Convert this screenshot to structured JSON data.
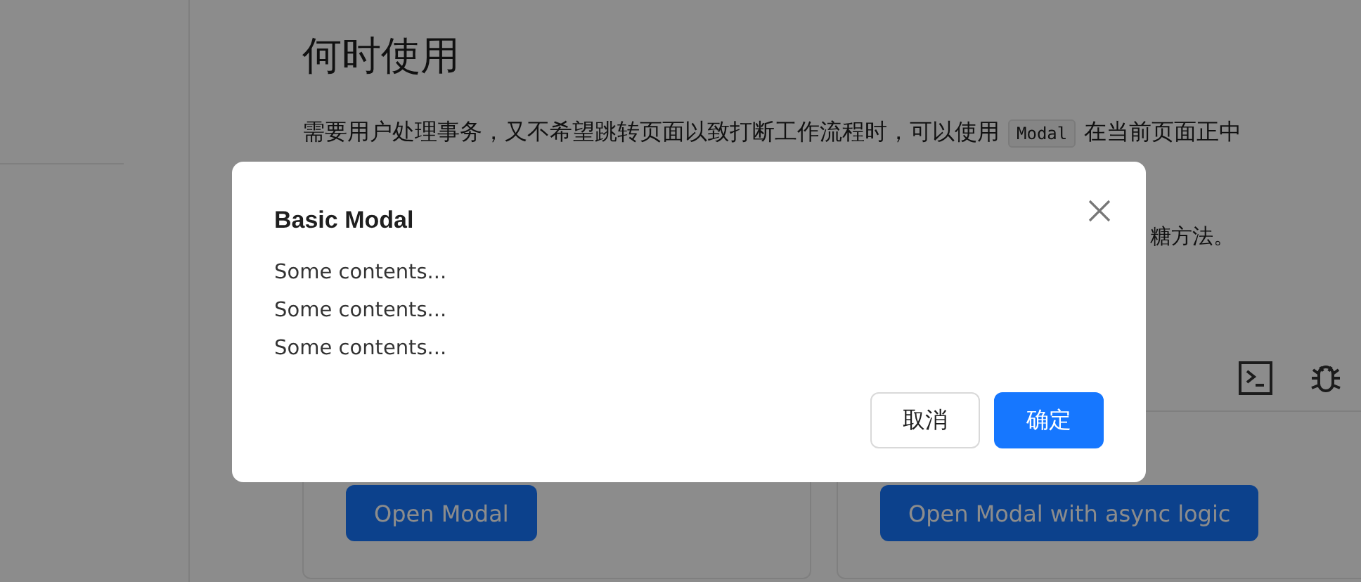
{
  "page": {
    "heading": "何时使用",
    "paragraph": {
      "before": "需要用户处理事务，又不希望跳转页面以致打断工作流程时，可以使用",
      "code": "Modal",
      "after": "在当前页面正中"
    },
    "fragment": "糖方法。",
    "demo_buttons": [
      "Open Modal",
      "Open Modal with async logic"
    ]
  },
  "modal": {
    "title": "Basic Modal",
    "contents": [
      "Some contents...",
      "Some contents...",
      "Some contents..."
    ],
    "buttons": [
      {
        "label": "取消",
        "kind": "default"
      },
      {
        "label": "确定",
        "kind": "primary"
      }
    ]
  }
}
